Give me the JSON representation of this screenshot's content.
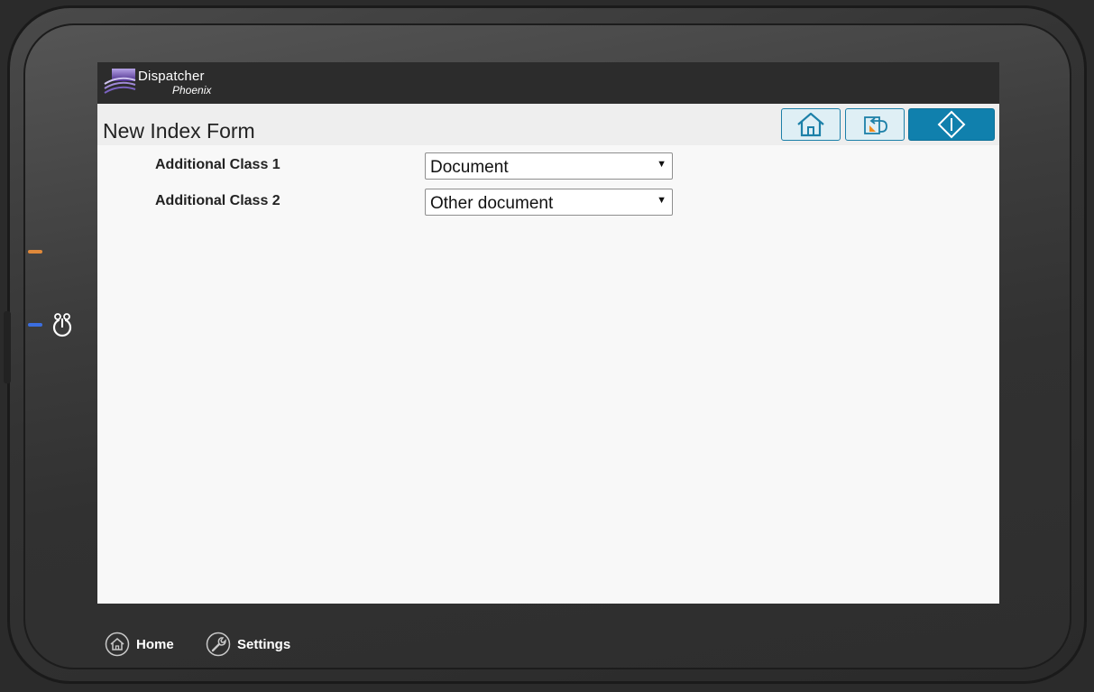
{
  "app": {
    "logo_line1": "Dispatcher",
    "logo_line2": "Phoenix"
  },
  "page": {
    "title": "New Index Form"
  },
  "toolbar": {
    "home_icon": "home-icon",
    "back_icon": "back-icon",
    "start_icon": "start-icon"
  },
  "form": {
    "fields": [
      {
        "label": "Additional Class 1",
        "value": "Document"
      },
      {
        "label": "Additional Class 2",
        "value": "Other document"
      }
    ]
  },
  "bottom_nav": {
    "home_label": "Home",
    "settings_label": "Settings"
  },
  "colors": {
    "accent": "#1080ad",
    "accent_light": "#dfeff5",
    "led_orange": "#e0893a",
    "led_blue": "#3b6ee0"
  }
}
